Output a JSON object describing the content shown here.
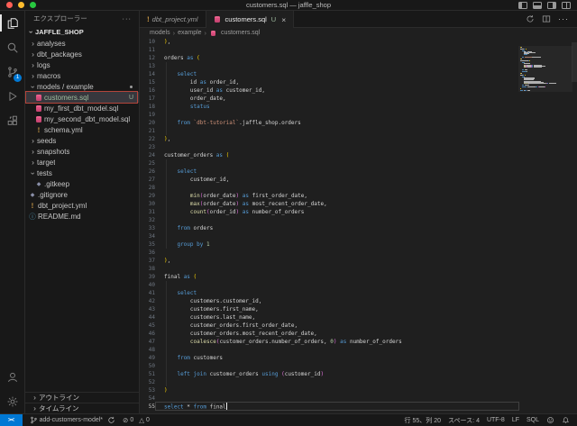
{
  "window": {
    "title": "customers.sql — jaffle_shop"
  },
  "colors": {
    "accent": "#0078d4",
    "sql_icon": "#d94f7e",
    "annotation_box": "#b3453b",
    "traffic_lights": [
      "#ff5f57",
      "#febc2e",
      "#28c840"
    ]
  },
  "activity_bar": {
    "items": [
      "explorer",
      "search",
      "source-control",
      "run-debug",
      "extensions",
      "accounts",
      "settings"
    ],
    "scm_badge": "1"
  },
  "explorer": {
    "title": "エクスプローラー",
    "root_label": "JAFFLE_SHOP",
    "items": [
      {
        "label": "analyses",
        "chev": "closed",
        "depth": 0
      },
      {
        "label": "dbt_packages",
        "chev": "closed",
        "depth": 0
      },
      {
        "label": "logs",
        "chev": "closed",
        "depth": 0
      },
      {
        "label": "macros",
        "chev": "closed",
        "depth": 0
      },
      {
        "label": "models / example",
        "chev": "open",
        "depth": 0,
        "dot": true
      },
      {
        "label": "customers.sql",
        "icon": "sql",
        "depth": 1,
        "badge": "U",
        "selected": true,
        "boxed": true,
        "git_new": true
      },
      {
        "label": "my_first_dbt_model.sql",
        "icon": "sql",
        "depth": 1
      },
      {
        "label": "my_second_dbt_model.sql",
        "icon": "sql",
        "depth": 1
      },
      {
        "label": "schema.yml",
        "icon": "warn",
        "depth": 1
      },
      {
        "label": "seeds",
        "chev": "closed",
        "depth": 0
      },
      {
        "label": "snapshots",
        "chev": "closed",
        "depth": 0
      },
      {
        "label": "target",
        "chev": "closed",
        "depth": 0
      },
      {
        "label": "tests",
        "chev": "open",
        "depth": 0
      },
      {
        "label": ".gitkeep",
        "icon": "git",
        "depth": 1
      },
      {
        "label": ".gitignore",
        "icon": "git",
        "depth": 0
      },
      {
        "label": "dbt_project.yml",
        "icon": "warn",
        "depth": 0
      },
      {
        "label": "README.md",
        "icon": "info",
        "depth": 0
      }
    ],
    "panels": {
      "outline": "アウトライン",
      "timeline": "タイムライン"
    }
  },
  "tabs": [
    {
      "label": "dbt_project.yml",
      "icon": "warning",
      "italic": true,
      "active": false
    },
    {
      "label": "customers.sql",
      "icon": "sql",
      "badge": "U",
      "close": "×",
      "active": true
    }
  ],
  "breadcrumb": {
    "segments": [
      "models",
      "example"
    ],
    "file": "customers.sql"
  },
  "editor": {
    "first_line": 10,
    "cursor_line": 55,
    "palette": {
      "kw": "#569cd6",
      "fn": "#dcdcaa",
      "str": "#ce9178",
      "num": "#b5cea8",
      "p1": "#ffd700",
      "p2": "#da70d6",
      "pl": "#d4d4d4"
    },
    "lines": [
      [
        [
          "p1",
          ")"
        ],
        [
          "pl",
          ","
        ]
      ],
      [],
      [
        [
          "pl",
          "orders "
        ],
        [
          "kw",
          "as"
        ],
        [
          "pl",
          " "
        ],
        [
          "p1",
          "("
        ]
      ],
      [],
      [
        [
          "pl",
          "    "
        ],
        [
          "kw",
          "select"
        ]
      ],
      [
        [
          "pl",
          "        id "
        ],
        [
          "kw",
          "as"
        ],
        [
          "pl",
          " order_id,"
        ]
      ],
      [
        [
          "pl",
          "        user_id "
        ],
        [
          "kw",
          "as"
        ],
        [
          "pl",
          " customer_id,"
        ]
      ],
      [
        [
          "pl",
          "        order_date,"
        ]
      ],
      [
        [
          "pl",
          "        "
        ],
        [
          "kw",
          "status"
        ]
      ],
      [],
      [
        [
          "pl",
          "    "
        ],
        [
          "kw",
          "from"
        ],
        [
          "pl",
          " "
        ],
        [
          "str",
          "`dbt-tutorial`"
        ],
        [
          "pl",
          ".jaffle_shop.orders"
        ]
      ],
      [],
      [
        [
          "p1",
          ")"
        ],
        [
          "pl",
          ","
        ]
      ],
      [],
      [
        [
          "pl",
          "customer_orders "
        ],
        [
          "kw",
          "as"
        ],
        [
          "pl",
          " "
        ],
        [
          "p1",
          "("
        ]
      ],
      [],
      [
        [
          "pl",
          "    "
        ],
        [
          "kw",
          "select"
        ]
      ],
      [
        [
          "pl",
          "        customer_id,"
        ]
      ],
      [],
      [
        [
          "pl",
          "        "
        ],
        [
          "fn",
          "min"
        ],
        [
          "p2",
          "("
        ],
        [
          "pl",
          "order_date"
        ],
        [
          "p2",
          ")"
        ],
        [
          "pl",
          " "
        ],
        [
          "kw",
          "as"
        ],
        [
          "pl",
          " first_order_date,"
        ]
      ],
      [
        [
          "pl",
          "        "
        ],
        [
          "fn",
          "max"
        ],
        [
          "p2",
          "("
        ],
        [
          "pl",
          "order_date"
        ],
        [
          "p2",
          ")"
        ],
        [
          "pl",
          " "
        ],
        [
          "kw",
          "as"
        ],
        [
          "pl",
          " most_recent_order_date,"
        ]
      ],
      [
        [
          "pl",
          "        "
        ],
        [
          "fn",
          "count"
        ],
        [
          "p2",
          "("
        ],
        [
          "pl",
          "order_id"
        ],
        [
          "p2",
          ")"
        ],
        [
          "pl",
          " "
        ],
        [
          "kw",
          "as"
        ],
        [
          "pl",
          " number_of_orders"
        ]
      ],
      [],
      [
        [
          "pl",
          "    "
        ],
        [
          "kw",
          "from"
        ],
        [
          "pl",
          " orders"
        ]
      ],
      [],
      [
        [
          "pl",
          "    "
        ],
        [
          "kw",
          "group by"
        ],
        [
          "pl",
          " "
        ],
        [
          "num",
          "1"
        ]
      ],
      [],
      [
        [
          "p1",
          ")"
        ],
        [
          "pl",
          ","
        ]
      ],
      [],
      [
        [
          "pl",
          "final "
        ],
        [
          "kw",
          "as"
        ],
        [
          "pl",
          " "
        ],
        [
          "p1",
          "("
        ]
      ],
      [],
      [
        [
          "pl",
          "    "
        ],
        [
          "kw",
          "select"
        ]
      ],
      [
        [
          "pl",
          "        customers.customer_id,"
        ]
      ],
      [
        [
          "pl",
          "        customers.first_name,"
        ]
      ],
      [
        [
          "pl",
          "        customers.last_name,"
        ]
      ],
      [
        [
          "pl",
          "        customer_orders.first_order_date,"
        ]
      ],
      [
        [
          "pl",
          "        customer_orders.most_recent_order_date,"
        ]
      ],
      [
        [
          "pl",
          "        "
        ],
        [
          "fn",
          "coalesce"
        ],
        [
          "p2",
          "("
        ],
        [
          "pl",
          "customer_orders.number_of_orders, "
        ],
        [
          "num",
          "0"
        ],
        [
          "p2",
          ")"
        ],
        [
          "pl",
          " "
        ],
        [
          "kw",
          "as"
        ],
        [
          "pl",
          " number_of_orders"
        ]
      ],
      [],
      [
        [
          "pl",
          "    "
        ],
        [
          "kw",
          "from"
        ],
        [
          "pl",
          " customers"
        ]
      ],
      [],
      [
        [
          "pl",
          "    "
        ],
        [
          "kw",
          "left join"
        ],
        [
          "pl",
          " customer_orders "
        ],
        [
          "kw",
          "using"
        ],
        [
          "pl",
          " "
        ],
        [
          "p2",
          "("
        ],
        [
          "pl",
          "customer_id"
        ],
        [
          "p2",
          ")"
        ]
      ],
      [],
      [
        [
          "p1",
          ")"
        ]
      ],
      [],
      [
        [
          "kw",
          "select"
        ],
        [
          "pl",
          " * "
        ],
        [
          "kw",
          "from"
        ],
        [
          "pl",
          " final"
        ]
      ]
    ]
  },
  "status_bar": {
    "branch": "add-customers-model*",
    "errors": "0",
    "warnings": "0",
    "line_col": "行 55、列 20",
    "spaces": "スペース: 4",
    "encoding": "UTF-8",
    "eol": "LF",
    "language": "SQL"
  }
}
